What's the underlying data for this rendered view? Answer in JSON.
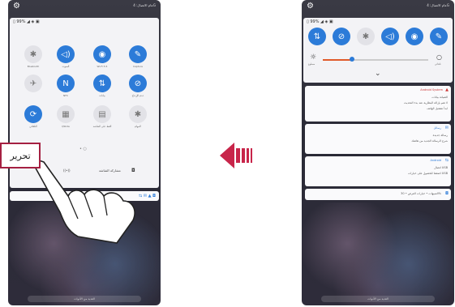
{
  "left_phone": {
    "status_tiny": "عام\nالاتصال: 4G",
    "panel_status": "▯ 99% ◢ ◈ ▣",
    "tiles": [
      {
        "icon": "✱",
        "label": "Bluetooth",
        "state": "off"
      },
      {
        "icon": "◁)",
        "label": "الصوت",
        "state": "on"
      },
      {
        "icon": "◉",
        "label": "Wi-Fi 5.5",
        "state": "on"
      },
      {
        "icon": "✎",
        "label": "Capture",
        "state": "on"
      },
      {
        "icon": "✈",
        "label": "",
        "state": "off"
      },
      {
        "icon": "N",
        "label": "NFC",
        "state": "on"
      },
      {
        "icon": "⇅",
        "label": "بيانات",
        "state": "on"
      },
      {
        "icon": "⊘",
        "label": "عدم الإزعاج",
        "state": "on"
      },
      {
        "icon": "⟳",
        "label": "التلقائي",
        "state": "on"
      },
      {
        "icon": "▦",
        "label": "QSlide",
        "state": "off"
      },
      {
        "icon": "▤",
        "label": "القط على الشاشة",
        "state": "off"
      },
      {
        "icon": "✱",
        "label": "المهام",
        "state": "off"
      }
    ],
    "page_dots": "• ○",
    "edit_label": "تحرير",
    "bottom_items": {
      "cast_icon": "((•))",
      "screen_share": "مشاركة الشاشة",
      "screen_share_icon": "◘"
    },
    "notif_icons": "⇆ ✉ ▲ ◘",
    "dock_label": "العديد من الأدوات"
  },
  "arrow": {
    "direction": "left"
  },
  "right_phone": {
    "status_tiny": "عام\nالاتصال: 4G",
    "panel_status": "▯ 99% ◢ ◈ ▣",
    "tiles": [
      {
        "icon": "⇅",
        "state": "on"
      },
      {
        "icon": "⊘",
        "state": "on"
      },
      {
        "icon": "✱",
        "state": "off"
      },
      {
        "icon": "◁)",
        "state": "on"
      },
      {
        "icon": "◉",
        "state": "on"
      },
      {
        "icon": "✎",
        "state": "on"
      }
    ],
    "brightness": {
      "level": 0.28,
      "label": "سطوع",
      "auto": "تلقائي"
    },
    "expand_icon": "⌄",
    "notifications": [
      {
        "app": "Android System",
        "lines": [
          "الصيانة بيانات",
          "لا تقم بإزالة البطارية عند بدء التحديث",
          "ابدأ تشغيل الهاتف"
        ],
        "alert": "▲"
      },
      {
        "app": "رسائل",
        "lines": [
          "رسالة جديدة",
          "شرح الرسالة الجديد من هاتفك"
        ],
        "alert": "✉"
      },
      {
        "app": "Android",
        "lines": [
          "اتصال USB",
          "اضغط للحصول على خيارات USB"
        ],
        "alert": "⇆"
      },
      {
        "app": "",
        "lines": [
          "التنبيهات • خيارات العرض • 30%"
        ],
        "alert": "◘"
      }
    ],
    "dock_label": "العديد من الأدوات"
  }
}
